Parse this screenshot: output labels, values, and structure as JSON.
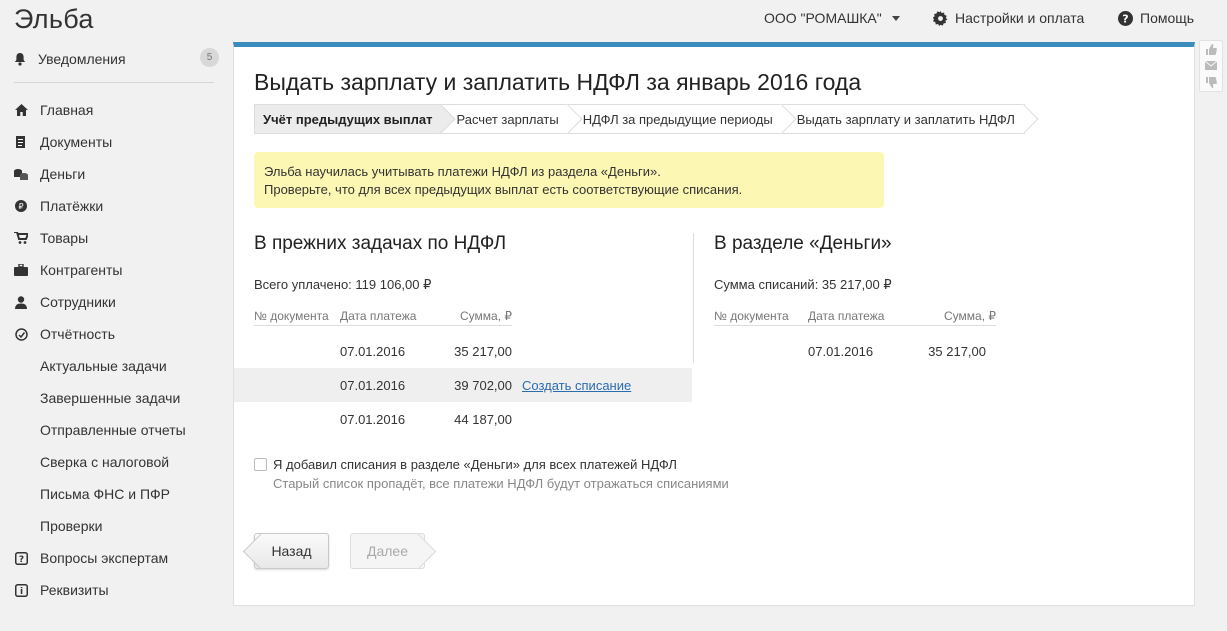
{
  "app": {
    "logo": "Эльба"
  },
  "sidebar": {
    "notifications": {
      "label": "Уведомления",
      "count": "5"
    },
    "items": [
      {
        "label": "Главная",
        "icon": "home-icon"
      },
      {
        "label": "Документы",
        "icon": "document-icon"
      },
      {
        "label": "Деньги",
        "icon": "coins-icon"
      },
      {
        "label": "Платёжки",
        "icon": "payment-icon"
      },
      {
        "label": "Товары",
        "icon": "cart-icon"
      },
      {
        "label": "Контрагенты",
        "icon": "briefcase-icon"
      },
      {
        "label": "Сотрудники",
        "icon": "person-icon"
      },
      {
        "label": "Отчётность",
        "icon": "report-icon"
      },
      {
        "label": "Актуальные задачи"
      },
      {
        "label": "Завершенные задачи"
      },
      {
        "label": "Отправленные отчеты"
      },
      {
        "label": "Сверка с налоговой"
      },
      {
        "label": "Письма ФНС и ПФР"
      },
      {
        "label": "Проверки"
      },
      {
        "label": "Вопросы экспертам",
        "icon": "question-box-icon"
      },
      {
        "label": "Реквизиты",
        "icon": "info-box-icon"
      }
    ]
  },
  "topbar": {
    "org": "ООО \"РОМАШКА\"",
    "settings": "Настройки и оплата",
    "help": "Помощь"
  },
  "page": {
    "title": "Выдать зарплату и заплатить НДФЛ за январь 2016 года",
    "steps": [
      "Учёт предыдущих выплат",
      "Расчет зарплаты",
      "НДФЛ за предыдущие периоды",
      "Выдать зарплату и заплатить НДФЛ"
    ],
    "notice": {
      "line1": "Эльба научилась учитывать платежи НДФЛ из раздела «Деньги».",
      "line2": "Проверьте, что для всех предыдущих выплат есть соответствующие списания."
    },
    "left": {
      "title": "В прежних задачах по НДФЛ",
      "total": "Всего уплачено: 119 106,00 ₽",
      "headers": [
        "№ документа",
        "Дата платежа",
        "Сумма, ₽"
      ],
      "rows": [
        {
          "doc": "",
          "date": "07.01.2016",
          "sum": "35 217,00",
          "action": ""
        },
        {
          "doc": "",
          "date": "07.01.2016",
          "sum": "39 702,00",
          "action": "Создать списание"
        },
        {
          "doc": "",
          "date": "07.01.2016",
          "sum": "44 187,00",
          "action": ""
        }
      ]
    },
    "right": {
      "title": "В разделе «Деньги»",
      "total": "Сумма списаний: 35 217,00 ₽",
      "headers": [
        "№ документа",
        "Дата платежа",
        "Сумма, ₽"
      ],
      "rows": [
        {
          "doc": "",
          "date": "07.01.2016",
          "sum": "35 217,00"
        }
      ]
    },
    "checkbox": {
      "label": "Я добавил списания в разделе «Деньги» для всех платежей НДФЛ",
      "hint": "Старый список пропадёт, все платежи НДФЛ будут отражаться списаниями",
      "checked": false
    },
    "buttons": {
      "back": "Назад",
      "next": "Далее"
    }
  },
  "colors": {
    "accent": "#3b8dbd",
    "notice_bg": "#fdf7b4",
    "link": "#2a6cb0"
  }
}
